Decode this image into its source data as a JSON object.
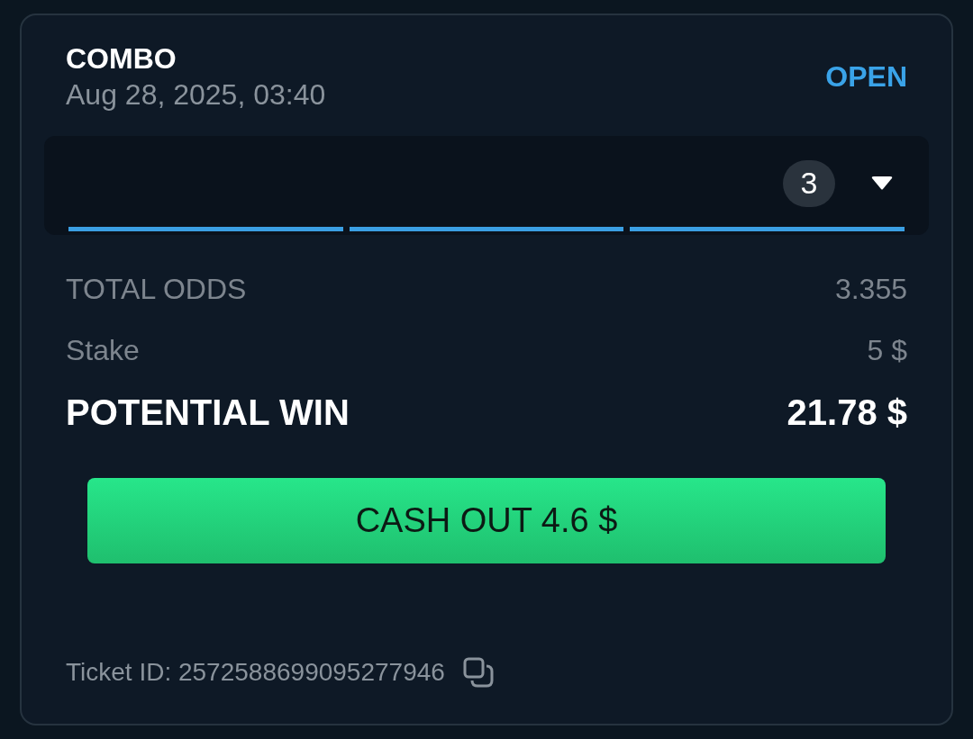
{
  "bet": {
    "type": "COMBO",
    "date": "Aug 28, 2025, 03:40",
    "status": "OPEN"
  },
  "selections": {
    "count": "3",
    "expanded": false,
    "legs": [
      {
        "color": "#3b9fe3"
      },
      {
        "color": "#3b9fe3"
      },
      {
        "color": "#3b9fe3"
      }
    ]
  },
  "rows": [
    {
      "label": "TOTAL ODDS",
      "value": "3.355",
      "kind": "muted"
    },
    {
      "label": "Stake",
      "value": "5 $",
      "kind": "muted"
    },
    {
      "label": "POTENTIAL WIN",
      "value": "21.78 $",
      "kind": "strong"
    }
  ],
  "cash_out_button": "CASH OUT 4.6 $",
  "ticket": "Ticket ID: 2572588699095277946"
}
